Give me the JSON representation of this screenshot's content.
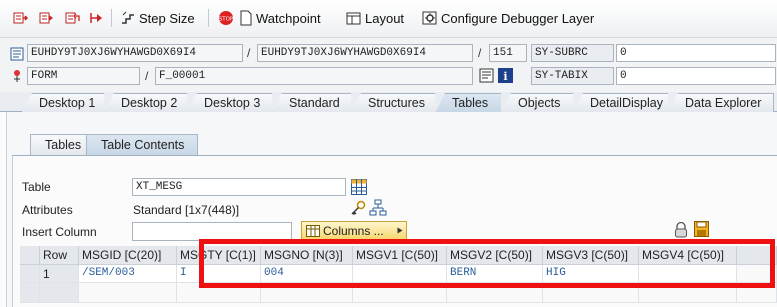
{
  "toolbar": {
    "step_size": "Step Size",
    "watchpoint": "Watchpoint",
    "layout": "Layout",
    "configure": "Configure Debugger Layer"
  },
  "vars": {
    "row1": {
      "field1": "EUHDY9TJ0XJ6WYHAWGD0X69I4",
      "field2": "EUHDY9TJ0XJ6WYHAWGD0X69I4",
      "line": "151",
      "sysvar": "SY-SUBRC",
      "sysval": "0"
    },
    "row2": {
      "field1": "FORM",
      "field2": "F_00001",
      "sysvar": "SY-TABIX",
      "sysval": "0"
    }
  },
  "desktop_tabs": [
    "Desktop 1",
    "Desktop 2",
    "Desktop 3",
    "Standard",
    "Structures",
    "Tables",
    "Objects",
    "DetailDisplay",
    "Data Explorer"
  ],
  "inner_tabs": [
    "Tables",
    "Table Contents"
  ],
  "table_form": {
    "table_label": "Table",
    "table_value": "XT_MESG",
    "attributes_label": "Attributes",
    "attributes_value": "Standard [1x7(448)]",
    "insert_column_label": "Insert Column",
    "columns_button": "Columns ..."
  },
  "grid": {
    "headers": [
      "Row",
      "MSGID [C(20)]",
      "MSGTY [C(1)]",
      "MSGNO [N(3)]",
      "MSGV1 [C(50)]",
      "MSGV2 [C(50)]",
      "MSGV3 [C(50)]",
      "MSGV4 [C(50)]"
    ],
    "rows": [
      [
        "1",
        "/SEM/003",
        "I",
        "004",
        "",
        "BERN",
        "HIG",
        ""
      ]
    ]
  },
  "colors": {
    "highlight": "#ee1111",
    "cell_text": "#2a5d9a"
  }
}
